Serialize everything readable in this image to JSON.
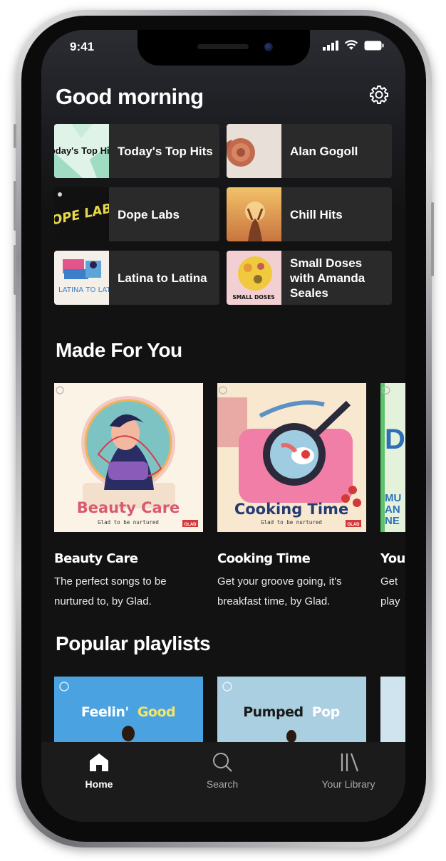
{
  "status_bar": {
    "time": "9:41"
  },
  "header": {
    "greeting": "Good morning"
  },
  "quick_tiles": [
    {
      "label": "Today's Top Hits",
      "art_text": "Today's Top Hits"
    },
    {
      "label": "Alan Gogoll"
    },
    {
      "label": "Dope Labs",
      "art_text": "DOPE LABS"
    },
    {
      "label": "Chill Hits"
    },
    {
      "label": "Latina to Latina",
      "art_text": "LATINA TO LATINA"
    },
    {
      "label": "Small Doses with Amanda Seales",
      "art_text": "SMALL DOSES"
    }
  ],
  "made_for_you": {
    "title": "Made For You",
    "cards": [
      {
        "title": "Beauty Care",
        "description": "The perfect songs to be nurtured to, by Glad.",
        "art_title": "Beauty Care",
        "art_sub": "Glad to be nurtured",
        "badge": "GLAD"
      },
      {
        "title": "Cooking Time",
        "description": "Get your groove going, it's breakfast time, by Glad.",
        "art_title": "Cooking Time",
        "art_sub": "Glad to be nurtured",
        "badge": "GLAD"
      },
      {
        "title": "You",
        "description": "Get play",
        "art_lines": [
          "D",
          "MU",
          "AN",
          "NE"
        ]
      }
    ]
  },
  "popular_playlists": {
    "title": "Popular playlists",
    "items": [
      {
        "title_a": "Feelin'",
        "title_b": "Good"
      },
      {
        "title_a": "Pumped",
        "title_b": "Pop"
      }
    ]
  },
  "nav": {
    "home": "Home",
    "search": "Search",
    "library": "Your Library"
  },
  "colors": {
    "background": "#121212",
    "tile": "#2a2a2a",
    "navbar": "#1b1b1b",
    "feelin_blue": "#4aa3e0",
    "pumped_blue": "#a9cfe0"
  }
}
